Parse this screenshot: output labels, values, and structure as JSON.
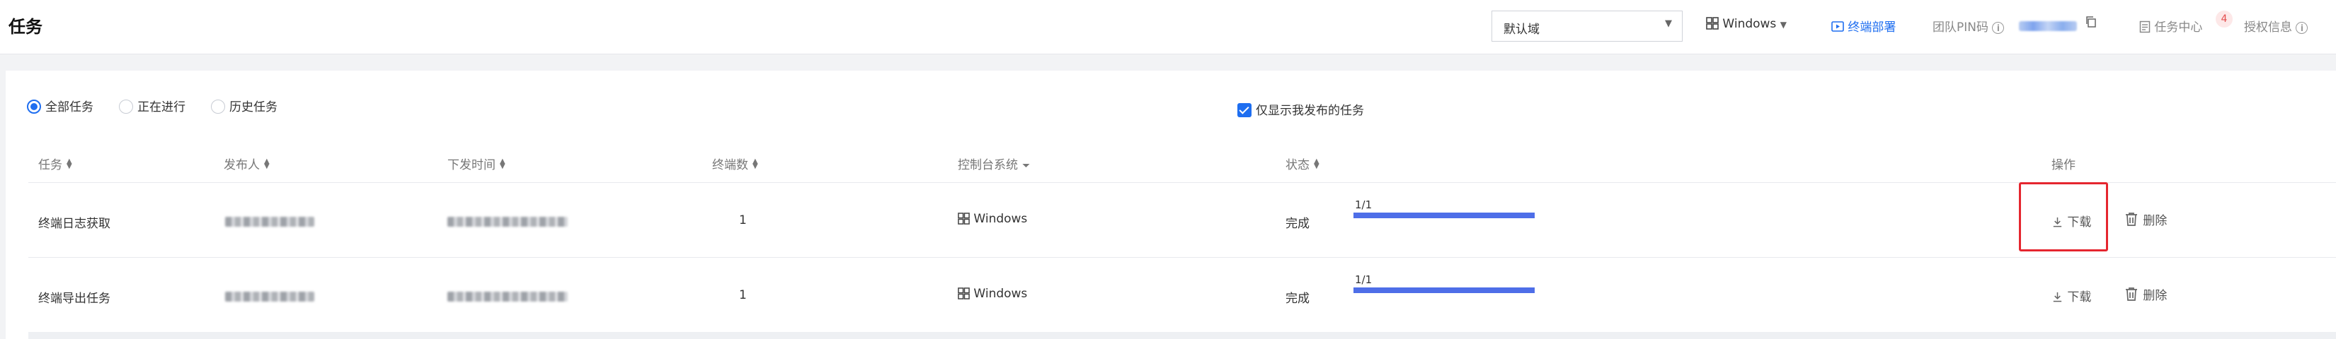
{
  "header": {
    "title": "任务",
    "domain_select": "默认域",
    "os_select": "Windows",
    "deploy_link": "终端部署",
    "team_pin_label": "团队PIN码",
    "task_center": "任务中心",
    "task_center_count": "4",
    "license_info": "授权信息"
  },
  "filters": {
    "radios": [
      {
        "label": "全部任务",
        "checked": true
      },
      {
        "label": "正在进行",
        "checked": false
      },
      {
        "label": "历史任务",
        "checked": false
      }
    ],
    "only_mine_label": "仅显示我发布的任务",
    "only_mine_checked": true
  },
  "table": {
    "columns": [
      "任务",
      "发布人",
      "下发时间",
      "终端数",
      "控制台系统",
      "状态",
      "操作"
    ],
    "rows": [
      {
        "task": "终端日志获取",
        "terminals": "1",
        "os": "Windows",
        "status": "完成",
        "progress_text": "1/1",
        "progress": 1.0,
        "download": "下载",
        "delete": "删除"
      },
      {
        "task": "终端导出任务",
        "terminals": "1",
        "os": "Windows",
        "status": "完成",
        "progress_text": "1/1",
        "progress": 1.0,
        "download": "下载",
        "delete": "删除"
      }
    ]
  },
  "colors": {
    "accent": "#1e6ef0",
    "progress": "#4e6ee8",
    "highlight": "#e5262f"
  }
}
